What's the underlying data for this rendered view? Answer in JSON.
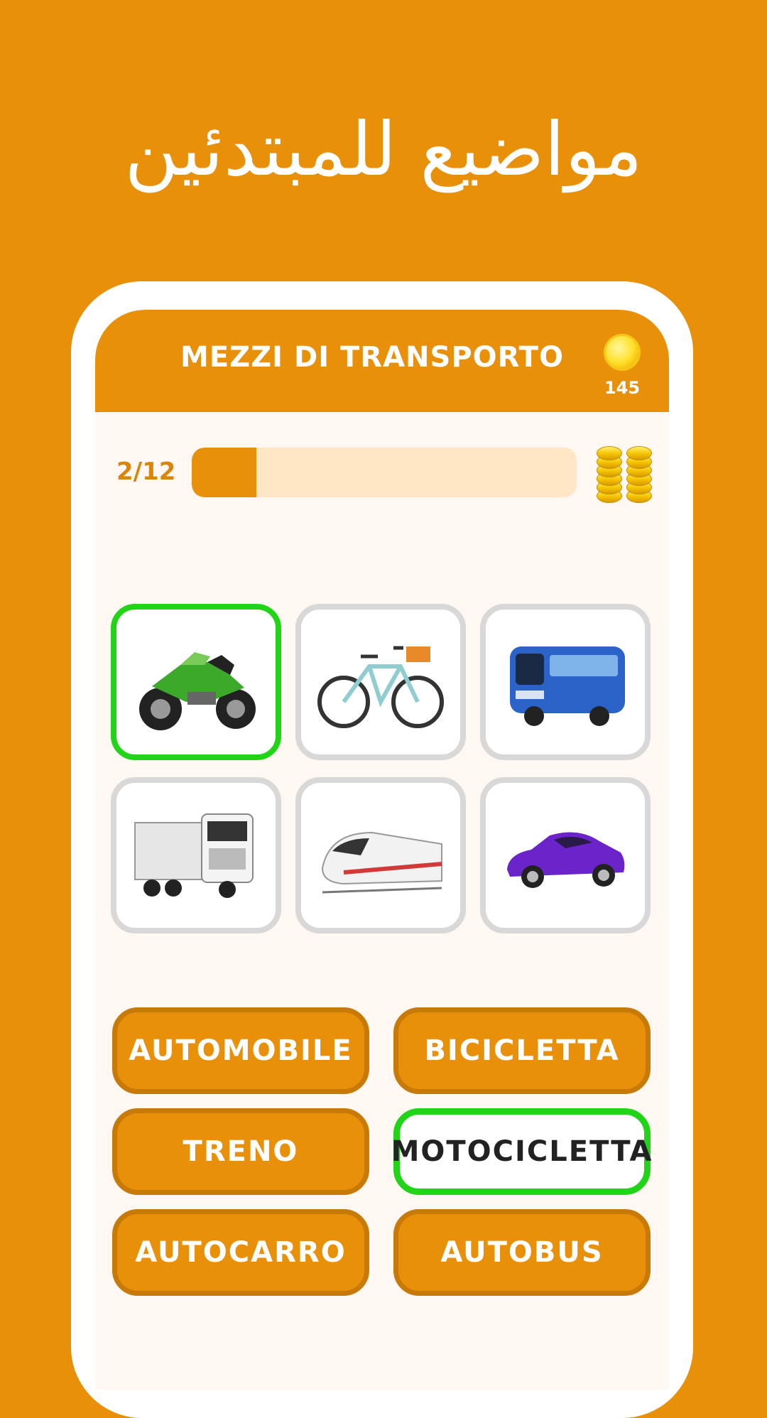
{
  "promo": {
    "title": "مواضيع للمبتدئين"
  },
  "header": {
    "title": "MEZZI DI TRANSPORTO",
    "coins": "145"
  },
  "progress": {
    "label": "2/12",
    "fraction": 0.167
  },
  "tiles": [
    {
      "icon": "motorcycle-icon",
      "state": "correct"
    },
    {
      "icon": "bicycle-icon",
      "state": "default"
    },
    {
      "icon": "bus-icon",
      "state": "default"
    },
    {
      "icon": "truck-icon",
      "state": "default"
    },
    {
      "icon": "train-icon",
      "state": "default"
    },
    {
      "icon": "car-icon",
      "state": "default"
    }
  ],
  "answers": [
    {
      "label": "AUTOMOBILE",
      "state": "default"
    },
    {
      "label": "BICICLETTA",
      "state": "default"
    },
    {
      "label": "TRENO",
      "state": "default"
    },
    {
      "label": "MOTOCICLETTA",
      "state": "selected"
    },
    {
      "label": "AUTOCARRO",
      "state": "default"
    },
    {
      "label": "AUTOBUS",
      "state": "default"
    }
  ],
  "colors": {
    "background": "#E8900A",
    "correct": "#22D418",
    "progress_track": "#FFE6C4",
    "screen": "#FFF8F2"
  }
}
